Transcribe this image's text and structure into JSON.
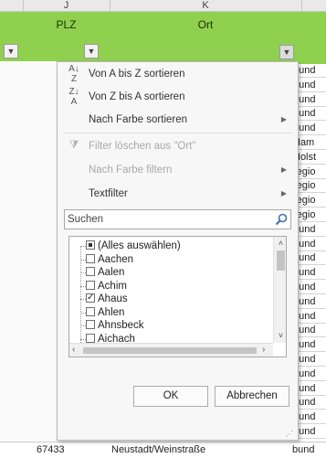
{
  "sheet": {
    "columns": [
      "J",
      "K"
    ],
    "header_labels": {
      "plz": "PLZ",
      "ort": "Ort"
    },
    "right_cells": [
      "bund",
      "bund",
      "bund",
      "bund",
      "bund",
      "Ham",
      "Holst",
      "regio",
      "regio",
      "regio",
      "regio",
      "bund",
      "bund",
      "bund",
      "bund",
      "bund",
      "bund",
      "bund",
      "bund",
      "bund",
      "bund",
      "bund",
      "bund",
      "bund",
      "bund",
      "bund"
    ],
    "bottom_row": {
      "plz": "67433",
      "ort": "Neustadt/Weinstraße",
      "right": "bund"
    }
  },
  "filter_menu": {
    "items": [
      {
        "label": "Von A bis Z sortieren",
        "icon": "sort-ascending-icon",
        "glyph_top": "A",
        "glyph_bottom": "Z",
        "submenu": false,
        "disabled": false
      },
      {
        "label": "Von Z bis A sortieren",
        "icon": "sort-descending-icon",
        "glyph_top": "Z",
        "glyph_bottom": "A",
        "submenu": false,
        "disabled": false
      },
      {
        "label": "Nach Farbe sortieren",
        "submenu": true,
        "disabled": false
      },
      {
        "label": "Filter löschen aus \"Ort\"",
        "icon": "clear-filter-icon",
        "submenu": false,
        "disabled": true
      },
      {
        "label": "Nach Farbe filtern",
        "submenu": true,
        "disabled": true
      },
      {
        "label": "Textfilter",
        "submenu": true,
        "disabled": false
      }
    ],
    "search_placeholder": "Suchen",
    "list": [
      {
        "label": "(Alles auswählen)",
        "state": "partial"
      },
      {
        "label": "Aachen",
        "state": "unchecked"
      },
      {
        "label": "Aalen",
        "state": "unchecked"
      },
      {
        "label": "Achim",
        "state": "unchecked"
      },
      {
        "label": "Ahaus",
        "state": "checked"
      },
      {
        "label": "Ahlen",
        "state": "unchecked"
      },
      {
        "label": "Ahnsbeck",
        "state": "unchecked"
      },
      {
        "label": "Aichach",
        "state": "unchecked"
      }
    ],
    "ok_label": "OK",
    "cancel_label": "Abbrechen"
  }
}
